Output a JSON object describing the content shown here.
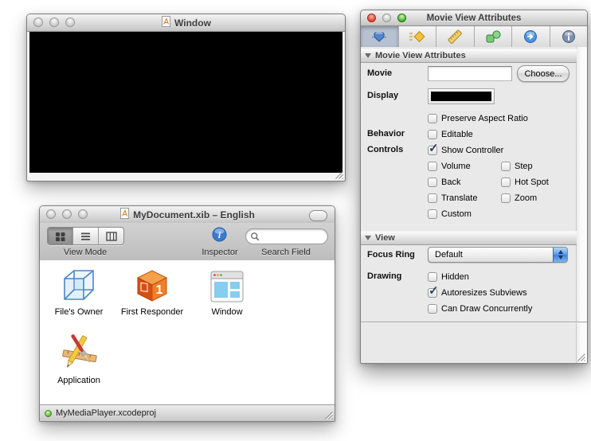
{
  "movie_window": {
    "title": "Window"
  },
  "doc_window": {
    "title": "MyDocument.xib – English",
    "toolbar": {
      "view_mode_label": "View Mode",
      "inspector_label": "Inspector",
      "search_field_label": "Search Field",
      "search_value": ""
    },
    "items": [
      {
        "label": "File's Owner",
        "icon": "files-owner-cube-icon"
      },
      {
        "label": "First Responder",
        "icon": "first-responder-cube-icon",
        "badge": "1"
      },
      {
        "label": "Window",
        "icon": "window-thumbnail-icon"
      },
      {
        "label": "Application",
        "icon": "application-icon"
      }
    ],
    "status_text": "MyMediaPlayer.xcodeproj"
  },
  "inspector_window": {
    "title": "Movie View Attributes",
    "toolbar_icons": [
      "attributes-icon",
      "effects-icon",
      "size-icon",
      "bindings-icon",
      "connections-icon",
      "identity-icon"
    ],
    "attributes_section": {
      "header": "Movie View Attributes",
      "movie_label": "Movie",
      "movie_value": "",
      "choose_label": "Choose...",
      "display_label": "Display",
      "display_color": "#000000",
      "behavior_label": "Behavior",
      "controls_label": "Controls",
      "checkboxes": {
        "preserve_aspect_ratio": {
          "label": "Preserve Aspect Ratio",
          "checked": false
        },
        "editable": {
          "label": "Editable",
          "checked": false
        },
        "show_controller": {
          "label": "Show Controller",
          "checked": true
        },
        "volume": {
          "label": "Volume",
          "checked": false
        },
        "step": {
          "label": "Step",
          "checked": false
        },
        "back": {
          "label": "Back",
          "checked": false
        },
        "hot_spot": {
          "label": "Hot Spot",
          "checked": false
        },
        "translate": {
          "label": "Translate",
          "checked": false
        },
        "zoom": {
          "label": "Zoom",
          "checked": false
        },
        "custom": {
          "label": "Custom",
          "checked": false
        }
      }
    },
    "view_section": {
      "header": "View",
      "focus_ring_label": "Focus Ring",
      "focus_ring_value": "Default",
      "drawing_label": "Drawing",
      "checkboxes": {
        "hidden": {
          "label": "Hidden",
          "checked": false
        },
        "autoresizes_subviews": {
          "label": "Autoresizes Subviews",
          "checked": true
        },
        "can_draw_concurrently": {
          "label": "Can Draw Concurrently",
          "checked": false
        }
      }
    }
  }
}
